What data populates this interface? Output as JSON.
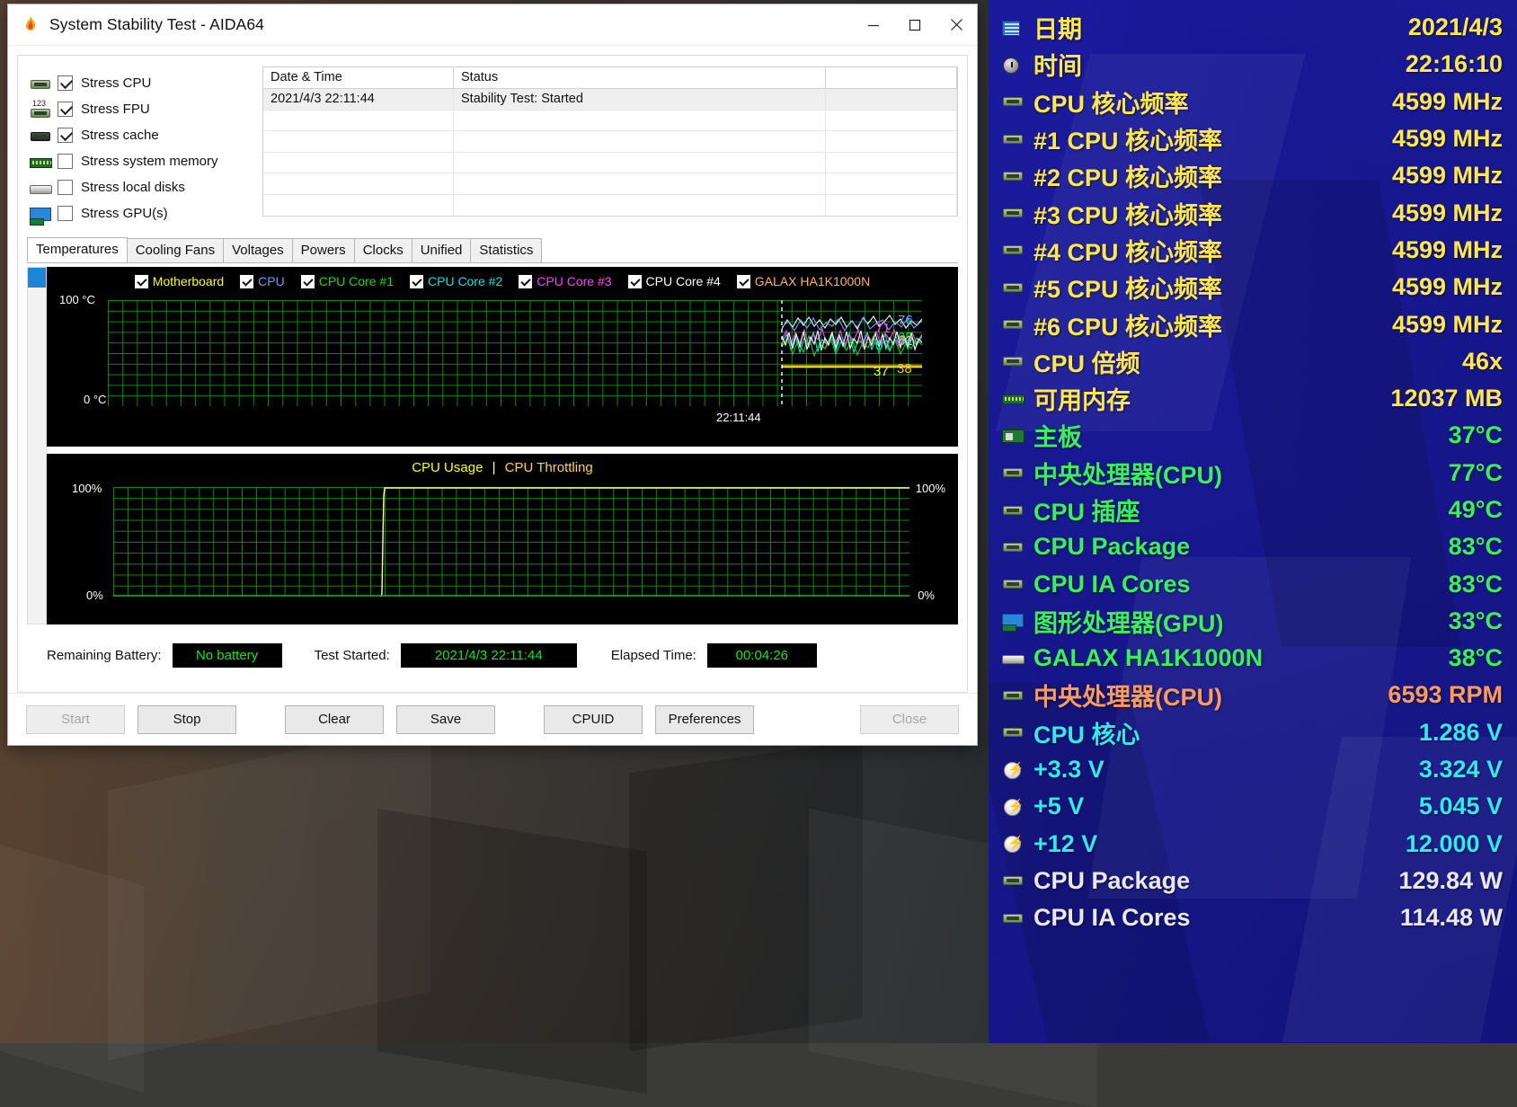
{
  "window": {
    "title": "System Stability Test - AIDA64",
    "icon": "flame-icon",
    "buttons": {
      "minimize": "—",
      "maximize": "□",
      "close": "✕"
    }
  },
  "stress_options": [
    {
      "label": "Stress CPU",
      "checked": true,
      "icon": "cpu-chip-icon"
    },
    {
      "label": "Stress FPU",
      "checked": true,
      "icon": "fpu-chip-icon"
    },
    {
      "label": "Stress cache",
      "checked": true,
      "icon": "cache-chip-icon"
    },
    {
      "label": "Stress system memory",
      "checked": false,
      "icon": "memory-module-icon"
    },
    {
      "label": "Stress local disks",
      "checked": false,
      "icon": "hard-disk-icon"
    },
    {
      "label": "Stress GPU(s)",
      "checked": false,
      "icon": "graphics-card-icon"
    }
  ],
  "log_table": {
    "columns": [
      "Date & Time",
      "Status"
    ],
    "rows": [
      {
        "datetime": "2021/4/3 22:11:44",
        "status": "Stability Test: Started"
      }
    ],
    "empty_rows": 5
  },
  "tabs": [
    {
      "label": "Temperatures",
      "active": true
    },
    {
      "label": "Cooling Fans",
      "active": false
    },
    {
      "label": "Voltages",
      "active": false
    },
    {
      "label": "Powers",
      "active": false
    },
    {
      "label": "Clocks",
      "active": false
    },
    {
      "label": "Unified",
      "active": false
    },
    {
      "label": "Statistics",
      "active": false
    }
  ],
  "chart_data": [
    {
      "type": "line",
      "name": "temperatures-chart",
      "title": "",
      "ylabel_top": "100 °C",
      "ylabel_bottom": "0 °C",
      "ylim": [
        0,
        100
      ],
      "xlabel": "22:11:44",
      "grid": true,
      "legend_position": "top",
      "series": [
        {
          "name": "Motherboard",
          "color": "#ffff00",
          "checked": true,
          "current": 37,
          "label": "37"
        },
        {
          "name": "CPU",
          "color": "#6d9eff",
          "checked": true,
          "current": 76,
          "label": "76"
        },
        {
          "name": "CPU Core #1",
          "color": "#00e000",
          "checked": true,
          "current": 65,
          "label": "65"
        },
        {
          "name": "CPU Core #2",
          "color": "#00e5e5",
          "checked": true,
          "current": 57,
          "label": "57"
        },
        {
          "name": "CPU Core #3",
          "color": "#ff44ff",
          "checked": true,
          "current": 71,
          "label": "71"
        },
        {
          "name": "CPU Core #4",
          "color": "#ffffff",
          "checked": true,
          "current": 62,
          "label": "62"
        },
        {
          "name": "GALAX HA1K1000N",
          "color": "#ffb45a",
          "checked": true,
          "current": 38,
          "label": "38"
        }
      ]
    },
    {
      "type": "line",
      "name": "cpu-usage-chart",
      "title_parts": [
        {
          "text": "CPU Usage",
          "color": "#ffff00"
        },
        {
          "text": "|",
          "color": "#ffffff"
        },
        {
          "text": "CPU Throttling",
          "color": "#ffd24d"
        }
      ],
      "ylabel_top_left": "100%",
      "ylabel_bottom_left": "0%",
      "ylabel_top_right": "100%",
      "ylabel_bottom_right": "0%",
      "ylim": [
        0,
        100
      ],
      "grid": true,
      "series": [
        {
          "name": "CPU Usage",
          "color": "#ffff9c",
          "current": 100
        },
        {
          "name": "CPU Throttling",
          "color": "#00c000",
          "current": 0
        }
      ]
    }
  ],
  "status": {
    "battery_label": "Remaining Battery:",
    "battery_value": "No battery",
    "started_label": "Test Started:",
    "started_value": "2021/4/3 22:11:44",
    "elapsed_label": "Elapsed Time:",
    "elapsed_value": "00:04:26"
  },
  "buttons": [
    {
      "label": "Start",
      "disabled": true,
      "accel": "S"
    },
    {
      "label": "Stop",
      "disabled": false,
      "accel": "t"
    },
    {
      "label": "Clear",
      "disabled": false,
      "accel": "a"
    },
    {
      "label": "Save",
      "disabled": false,
      "accel": "a"
    },
    {
      "label": "CPUID",
      "disabled": false,
      "accel": "U"
    },
    {
      "label": "Preferences",
      "disabled": false,
      "accel": "P"
    },
    {
      "label": "Close",
      "disabled": true,
      "accel": "C"
    }
  ],
  "osd": {
    "colors": {
      "yellow": "#ffe84d",
      "green": "#3bf05a",
      "orange": "#ff9b5c",
      "cyan": "#34e8f0",
      "white": "#e8e8f0"
    },
    "rows": [
      {
        "icon": "calendar-clock-icon",
        "name": "日期",
        "value": "2021/4/3",
        "color": "yellow"
      },
      {
        "icon": "clock-icon",
        "name": "时间",
        "value": "22:16:10",
        "color": "yellow"
      },
      {
        "icon": "cpu-chip-icon",
        "name": "CPU 核心频率",
        "value": "4599 MHz",
        "color": "yellow"
      },
      {
        "icon": "cpu-chip-icon",
        "name": "#1 CPU 核心频率",
        "value": "4599 MHz",
        "color": "yellow"
      },
      {
        "icon": "cpu-chip-icon",
        "name": "#2 CPU 核心频率",
        "value": "4599 MHz",
        "color": "yellow"
      },
      {
        "icon": "cpu-chip-icon",
        "name": "#3 CPU 核心频率",
        "value": "4599 MHz",
        "color": "yellow"
      },
      {
        "icon": "cpu-chip-icon",
        "name": "#4 CPU 核心频率",
        "value": "4599 MHz",
        "color": "yellow"
      },
      {
        "icon": "cpu-chip-icon",
        "name": "#5 CPU 核心频率",
        "value": "4599 MHz",
        "color": "yellow"
      },
      {
        "icon": "cpu-chip-icon",
        "name": "#6 CPU 核心频率",
        "value": "4599 MHz",
        "color": "yellow"
      },
      {
        "icon": "cpu-chip-icon",
        "name": "CPU 倍频",
        "value": "46x",
        "color": "yellow"
      },
      {
        "icon": "memory-module-icon",
        "name": "可用内存",
        "value": "12037 MB",
        "color": "yellow"
      },
      {
        "icon": "motherboard-icon",
        "name": "主板",
        "value": "37°C",
        "color": "green"
      },
      {
        "icon": "cpu-chip-icon",
        "name": "中央处理器(CPU)",
        "value": "77°C",
        "color": "green"
      },
      {
        "icon": "cpu-chip-icon",
        "name": "CPU 插座",
        "value": "49°C",
        "color": "green"
      },
      {
        "icon": "cpu-chip-icon",
        "name": "CPU Package",
        "value": "83°C",
        "color": "green"
      },
      {
        "icon": "cpu-chip-icon",
        "name": "CPU IA Cores",
        "value": "83°C",
        "color": "green"
      },
      {
        "icon": "graphics-card-icon",
        "name": "图形处理器(GPU)",
        "value": "33°C",
        "color": "green"
      },
      {
        "icon": "hard-disk-icon",
        "name": "GALAX HA1K1000N",
        "value": "38°C",
        "color": "green"
      },
      {
        "icon": "cpu-chip-icon",
        "name": "中央处理器(CPU)",
        "value": "6593 RPM",
        "color": "orange"
      },
      {
        "icon": "cpu-chip-icon",
        "name": "CPU 核心",
        "value": "1.286 V",
        "color": "cyan"
      },
      {
        "icon": "voltage-bolt-icon",
        "name": "+3.3 V",
        "value": "3.324 V",
        "color": "cyan"
      },
      {
        "icon": "voltage-bolt-icon",
        "name": "+5 V",
        "value": "5.045 V",
        "color": "cyan"
      },
      {
        "icon": "voltage-bolt-icon",
        "name": "+12 V",
        "value": "12.000 V",
        "color": "cyan"
      },
      {
        "icon": "cpu-chip-icon",
        "name": "CPU Package",
        "value": "129.84 W",
        "color": "white"
      },
      {
        "icon": "cpu-chip-icon",
        "name": "CPU IA Cores",
        "value": "114.48 W",
        "color": "white"
      }
    ]
  }
}
